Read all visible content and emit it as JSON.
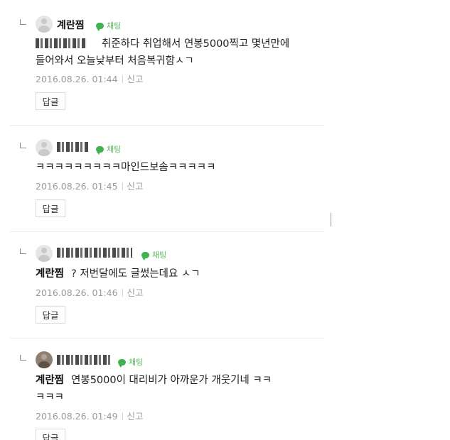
{
  "comments": [
    {
      "author": "",
      "chat_label": "채팅",
      "mention": "",
      "text_line1": "취준하다 취업해서 연봉5000찍고 몇년만에",
      "text_line2": "들어와서 오늘낮부터 처음복귀함ㅅㄱ",
      "date": "2016.08.26. 01:44",
      "report": "신고",
      "reply": "답글"
    },
    {
      "author": "",
      "chat_label": "채팅",
      "mention": "",
      "text_line1": "ㅋㅋㅋㅋㅋㅋㅋㅋㅋ마인드보솜ㅋㅋㅋㅋㅋ",
      "text_line2": "",
      "date": "2016.08.26. 01:45",
      "report": "신고",
      "reply": "답글"
    },
    {
      "author": "",
      "chat_label": "채팅",
      "mention": "계란찜",
      "text_line1": "? 저번달에도 글썼는데요 ㅅㄱ",
      "text_line2": "",
      "date": "2016.08.26. 01:46",
      "report": "신고",
      "reply": "답글"
    },
    {
      "author": "",
      "chat_label": "채팅",
      "mention": "계란찜",
      "text_line1": "연봉5000이 대리비가 아까운가 개웃기네 ㅋㅋ",
      "text_line2": "ㅋㅋㅋ",
      "date": "2016.08.26. 01:49",
      "report": "신고",
      "reply": "답글"
    }
  ],
  "first_author": "계란찜"
}
